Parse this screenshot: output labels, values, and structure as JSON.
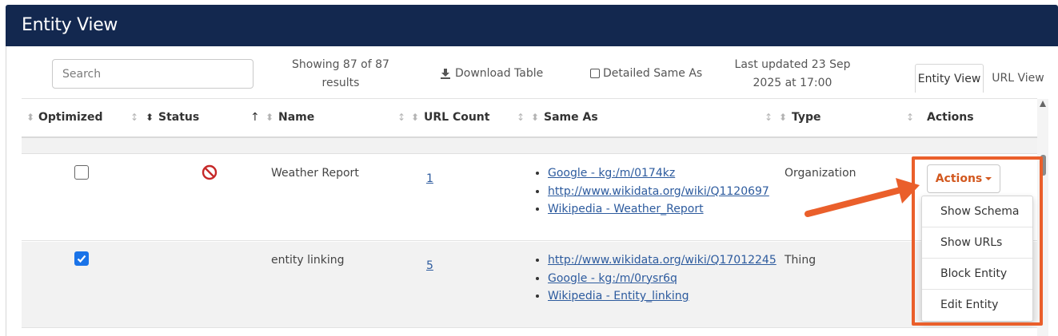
{
  "header": {
    "title": "Entity View"
  },
  "toolbar": {
    "search_placeholder": "Search",
    "showing_text": "Showing 87 of 87 results",
    "download_label": "Download Table",
    "detailed_same_as_label": "Detailed Same As",
    "last_updated": "Last updated 23 Sep 2025 at 17:00",
    "tabs": [
      {
        "label": "Entity View",
        "active": true
      },
      {
        "label": "URL View",
        "active": false
      }
    ]
  },
  "table": {
    "columns": [
      "Optimized",
      "Status",
      "Name",
      "URL Count",
      "Same As",
      "Type",
      "Actions"
    ],
    "rows": [
      {
        "optimized": false,
        "status": "blocked",
        "name": "Weather Report",
        "url_count": "1",
        "same_as": [
          "Google - kg:/m/0174kz ",
          "http://www.wikidata.org/wiki/Q1120697 ",
          "Wikipedia - Weather_Report "
        ],
        "type": "Organization"
      },
      {
        "optimized": true,
        "status": "",
        "name": "entity linking",
        "url_count": "5",
        "same_as": [
          "http://www.wikidata.org/wiki/Q17012245 ",
          "Google - kg:/m/0rysr6q ",
          "Wikipedia - Entity_linking "
        ],
        "type": "Thing"
      }
    ]
  },
  "actions_menu": {
    "button_label": "Actions",
    "items": [
      "Show Schema",
      "Show URLs",
      "Block Entity",
      "Edit Entity"
    ]
  },
  "colors": {
    "header_bg": "#13284f",
    "accent_orange": "#ea5f2b",
    "actions_text": "#d2581f",
    "link": "#2d5b9e",
    "status_blocked": "#c62828",
    "checkbox_checked": "#1a73e8"
  },
  "icons": {
    "download": "download-icon",
    "status_blocked": "blocked-icon",
    "annotation": "arrow-annotation"
  }
}
